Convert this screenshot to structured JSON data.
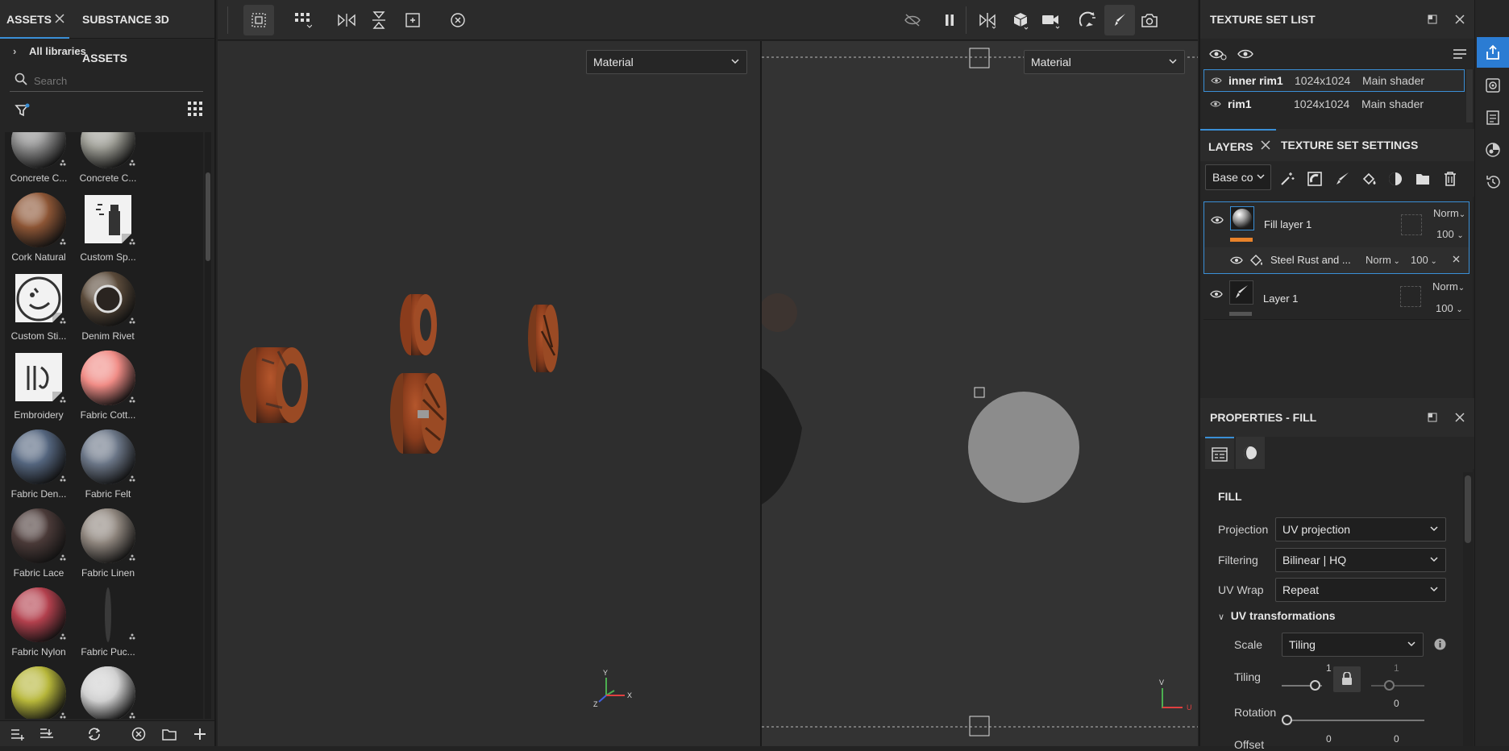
{
  "assets_panel": {
    "tab_assets": "ASSETS",
    "tab_substance": "SUBSTANCE 3D ASSETS",
    "all_libraries": "All libraries",
    "search_placeholder": "Search",
    "items": [
      {
        "label": "Concrete C...",
        "color": "#8a8a8a",
        "kind": "sphere"
      },
      {
        "label": "Concrete C...",
        "color": "#9b9b93",
        "kind": "sphere"
      },
      {
        "label": "Cork Natural",
        "color": "#8c5535",
        "kind": "sphere"
      },
      {
        "label": "Custom Sp...",
        "color": "#e8e8e8",
        "kind": "spray-icon"
      },
      {
        "label": "Custom Sti...",
        "color": "#e8e8e8",
        "kind": "sticker-icon"
      },
      {
        "label": "Denim Rivet",
        "color": "#5a4a3a",
        "kind": "rivet"
      },
      {
        "label": "Embroidery",
        "color": "#e8e8e8",
        "kind": "embroidery-icon"
      },
      {
        "label": "Fabric Cott...",
        "color": "#f08c86",
        "kind": "sphere"
      },
      {
        "label": "Fabric Den...",
        "color": "#54657e",
        "kind": "sphere"
      },
      {
        "label": "Fabric Felt",
        "color": "#6b7687",
        "kind": "sphere"
      },
      {
        "label": "Fabric Lace",
        "color": "#4a3a38",
        "kind": "sphere"
      },
      {
        "label": "Fabric Linen",
        "color": "#8e857d",
        "kind": "sphere"
      },
      {
        "label": "Fabric Nylon",
        "color": "#b2404d",
        "kind": "sphere"
      },
      {
        "label": "Fabric Puc...",
        "color": "#3a3a3a",
        "kind": "thin"
      },
      {
        "label": "",
        "color": "#b6b63a",
        "kind": "sphere"
      },
      {
        "label": "",
        "color": "#cfcfcf",
        "kind": "sphere"
      }
    ]
  },
  "viewport_left": {
    "mode": "Material"
  },
  "viewport_right": {
    "mode": "Material"
  },
  "texture_set_list": {
    "title": "TEXTURE SET LIST",
    "rows": [
      {
        "name": "inner rim1",
        "size": "1024x1024",
        "shader": "Main shader"
      },
      {
        "name": "rim1",
        "size": "1024x1024",
        "shader": "Main shader"
      }
    ]
  },
  "layers_panel": {
    "tab_layers": "LAYERS",
    "tab_settings": "TEXTURE SET SETTINGS",
    "channel": "Base co",
    "layers": [
      {
        "name": "Fill layer 1",
        "blend": "Norm",
        "opacity": "100"
      },
      {
        "name": "Layer 1",
        "blend": "Norm",
        "opacity": "100"
      }
    ],
    "effect": {
      "name": "Steel Rust and ...",
      "blend": "Norm",
      "opacity": "100"
    }
  },
  "properties": {
    "title": "PROPERTIES - FILL",
    "section": "FILL",
    "projection_label": "Projection",
    "projection_value": "UV projection",
    "filtering_label": "Filtering",
    "filtering_value": "Bilinear | HQ",
    "uvwrap_label": "UV Wrap",
    "uvwrap_value": "Repeat",
    "uvtrans_label": "UV transformations",
    "scale_label": "Scale",
    "scale_value": "Tiling",
    "tiling_label": "Tiling",
    "tiling_value_1": "1",
    "tiling_value_2": "1",
    "rotation_label": "Rotation",
    "rotation_value": "0",
    "offset_label": "Offset",
    "offset_value_1": "0",
    "offset_value_2": "0"
  },
  "colors": {
    "accent": "#3a8fd6",
    "orange": "#e8822a"
  }
}
